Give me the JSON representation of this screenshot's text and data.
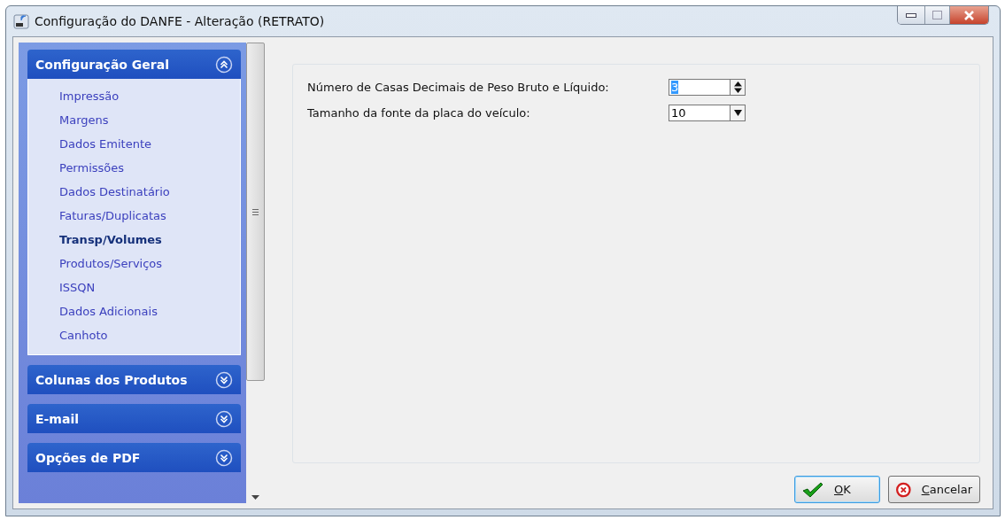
{
  "window": {
    "title": "Configuração do DANFE - Alteração  (RETRATO)"
  },
  "sidebar": {
    "groups": [
      {
        "title": "Configuração Geral",
        "expanded": true,
        "items": [
          {
            "label": "Impressão",
            "selected": false
          },
          {
            "label": "Margens",
            "selected": false
          },
          {
            "label": "Dados Emitente",
            "selected": false
          },
          {
            "label": "Permissões",
            "selected": false
          },
          {
            "label": "Dados Destinatário",
            "selected": false
          },
          {
            "label": "Faturas/Duplicatas",
            "selected": false
          },
          {
            "label": "Transp/Volumes",
            "selected": true
          },
          {
            "label": "Produtos/Serviços",
            "selected": false
          },
          {
            "label": "ISSQN",
            "selected": false
          },
          {
            "label": "Dados Adicionais",
            "selected": false
          },
          {
            "label": "Canhoto",
            "selected": false
          }
        ]
      },
      {
        "title": "Colunas dos Produtos",
        "expanded": false
      },
      {
        "title": "E-mail",
        "expanded": false
      },
      {
        "title": "Opções de PDF",
        "expanded": false
      }
    ]
  },
  "fields": [
    {
      "kind": "spinner",
      "label": "Número de Casas Decimais de Peso Bruto e Líquido:",
      "value": "3",
      "value_selected": true
    },
    {
      "kind": "dropdown",
      "label": "Tamanho da fonte da placa do veículo:",
      "value": "10",
      "value_selected": false
    }
  ],
  "buttons": [
    {
      "kind": "ok",
      "mnemonic": "O",
      "label_rest": "K",
      "focused": true
    },
    {
      "kind": "cancel",
      "mnemonic": "C",
      "label_rest": "ancelar",
      "focused": false
    }
  ]
}
